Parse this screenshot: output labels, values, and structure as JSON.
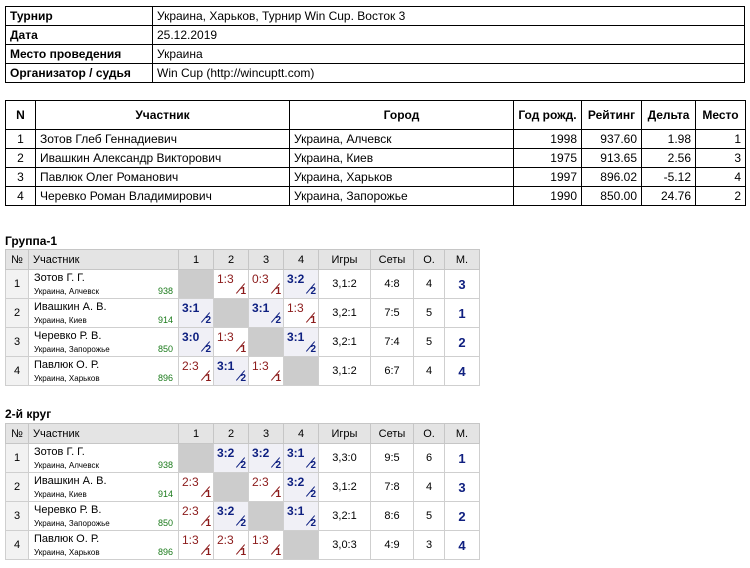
{
  "info": [
    {
      "label": "Турнир",
      "value": "Украина, Харьков, Турнир Win Cup. Восток 3"
    },
    {
      "label": "Дата",
      "value": "25.12.2019"
    },
    {
      "label": "Место проведения",
      "value": "Украина"
    },
    {
      "label": "Организатор / судья",
      "value": "Win Cup (http://wincuptt.com)"
    }
  ],
  "participants": {
    "headers": {
      "n": "N",
      "name": "Участник",
      "city": "Город",
      "birth": "Год рожд.",
      "rating": "Рейтинг",
      "delta": "Дельта",
      "place": "Место"
    },
    "rows": [
      {
        "n": "1",
        "name": "Зотов Глеб Геннадиевич",
        "city": "Украина, Алчевск",
        "birth": "1998",
        "rating": "937.60",
        "delta": "1.98",
        "place": "1"
      },
      {
        "n": "2",
        "name": "Ивашкин Александр Викторович",
        "city": "Украина, Киев",
        "birth": "1975",
        "rating": "913.65",
        "delta": "2.56",
        "place": "3"
      },
      {
        "n": "3",
        "name": "Павлюк Олег Романович",
        "city": "Украина, Харьков",
        "birth": "1997",
        "rating": "896.02",
        "delta": "-5.12",
        "place": "4"
      },
      {
        "n": "4",
        "name": "Черевко Роман Владимирович",
        "city": "Украина, Запорожье",
        "birth": "1990",
        "rating": "850.00",
        "delta": "24.76",
        "place": "2"
      }
    ]
  },
  "group_headers": {
    "num": "№",
    "player": "Участник",
    "c1": "1",
    "c2": "2",
    "c3": "3",
    "c4": "4",
    "games": "Игры",
    "sets": "Сеты",
    "points": "О.",
    "place": "М."
  },
  "groups": [
    {
      "title": "Группа-1",
      "rows": [
        {
          "num": "1",
          "name": "Зотов Г. Г.",
          "city": "Украина, Алчевск",
          "rating": "938",
          "results": [
            null,
            {
              "score": "1:3",
              "pts": "1",
              "win": false
            },
            {
              "score": "0:3",
              "pts": "1",
              "win": false
            },
            {
              "score": "3:2",
              "pts": "2",
              "win": true
            }
          ],
          "games": "3,1:2",
          "sets": "4:8",
          "points": "4",
          "place": "3"
        },
        {
          "num": "2",
          "name": "Ивашкин А. В.",
          "city": "Украина, Киев",
          "rating": "914",
          "results": [
            {
              "score": "3:1",
              "pts": "2",
              "win": true
            },
            null,
            {
              "score": "3:1",
              "pts": "2",
              "win": true
            },
            {
              "score": "1:3",
              "pts": "1",
              "win": false
            }
          ],
          "games": "3,2:1",
          "sets": "7:5",
          "points": "5",
          "place": "1"
        },
        {
          "num": "3",
          "name": "Черевко Р. В.",
          "city": "Украина, Запорожье",
          "rating": "850",
          "results": [
            {
              "score": "3:0",
              "pts": "2",
              "win": true
            },
            {
              "score": "1:3",
              "pts": "1",
              "win": false
            },
            null,
            {
              "score": "3:1",
              "pts": "2",
              "win": true
            }
          ],
          "games": "3,2:1",
          "sets": "7:4",
          "points": "5",
          "place": "2"
        },
        {
          "num": "4",
          "name": "Павлюк О. Р.",
          "city": "Украина, Харьков",
          "rating": "896",
          "results": [
            {
              "score": "2:3",
              "pts": "1",
              "win": false
            },
            {
              "score": "3:1",
              "pts": "2",
              "win": true
            },
            {
              "score": "1:3",
              "pts": "1",
              "win": false
            },
            null
          ],
          "games": "3,1:2",
          "sets": "6:7",
          "points": "4",
          "place": "4"
        }
      ]
    },
    {
      "title": "2-й круг",
      "rows": [
        {
          "num": "1",
          "name": "Зотов Г. Г.",
          "city": "Украина, Алчевск",
          "rating": "938",
          "results": [
            null,
            {
              "score": "3:2",
              "pts": "2",
              "win": true
            },
            {
              "score": "3:2",
              "pts": "2",
              "win": true
            },
            {
              "score": "3:1",
              "pts": "2",
              "win": true
            }
          ],
          "games": "3,3:0",
          "sets": "9:5",
          "points": "6",
          "place": "1"
        },
        {
          "num": "2",
          "name": "Ивашкин А. В.",
          "city": "Украина, Киев",
          "rating": "914",
          "results": [
            {
              "score": "2:3",
              "pts": "1",
              "win": false
            },
            null,
            {
              "score": "2:3",
              "pts": "1",
              "win": false
            },
            {
              "score": "3:2",
              "pts": "2",
              "win": true
            }
          ],
          "games": "3,1:2",
          "sets": "7:8",
          "points": "4",
          "place": "3"
        },
        {
          "num": "3",
          "name": "Черевко Р. В.",
          "city": "Украина, Запорожье",
          "rating": "850",
          "results": [
            {
              "score": "2:3",
              "pts": "1",
              "win": false
            },
            {
              "score": "3:2",
              "pts": "2",
              "win": true
            },
            null,
            {
              "score": "3:1",
              "pts": "2",
              "win": true
            }
          ],
          "games": "3,2:1",
          "sets": "8:6",
          "points": "5",
          "place": "2"
        },
        {
          "num": "4",
          "name": "Павлюк О. Р.",
          "city": "Украина, Харьков",
          "rating": "896",
          "results": [
            {
              "score": "1:3",
              "pts": "1",
              "win": false
            },
            {
              "score": "2:3",
              "pts": "1",
              "win": false
            },
            {
              "score": "1:3",
              "pts": "1",
              "win": false
            },
            null
          ],
          "games": "3,0:3",
          "sets": "4:9",
          "points": "3",
          "place": "4"
        }
      ]
    }
  ]
}
